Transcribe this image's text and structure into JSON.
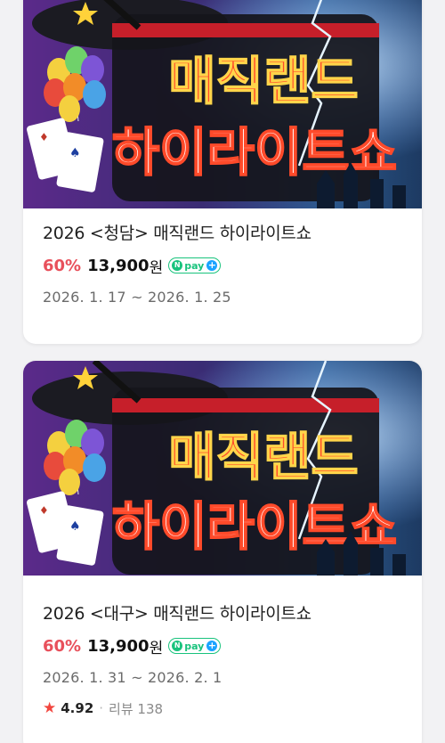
{
  "listings": [
    {
      "banner_line1": "매직랜드",
      "banner_line2": "하이라이트쇼",
      "title": "2026 <청담> 매직랜드 하이라이트쇼",
      "discount": "60%",
      "price": "13,900",
      "currency": "원",
      "npay_n": "N",
      "npay_label": "pay",
      "npay_plus": "+",
      "dates": "2026. 1. 17 ~ 2026. 1. 25"
    },
    {
      "banner_line1": "매직랜드",
      "banner_line2": "하이라이트쇼",
      "title": "2026 <대구> 매직랜드 하이라이트쇼",
      "discount": "60%",
      "price": "13,900",
      "currency": "원",
      "npay_n": "N",
      "npay_label": "pay",
      "npay_plus": "+",
      "dates": "2026. 1. 31 ~ 2026. 2. 1",
      "rating": "4.92",
      "separator": "·",
      "review_count": "리뷰 138"
    }
  ],
  "colors": {
    "discount": "#e8505b",
    "npay_green": "#19c37d",
    "npay_blue": "#1aa3ff",
    "star": "#f2463f",
    "banner_text": "#ff4a2a"
  },
  "icons": {
    "star": "★"
  }
}
